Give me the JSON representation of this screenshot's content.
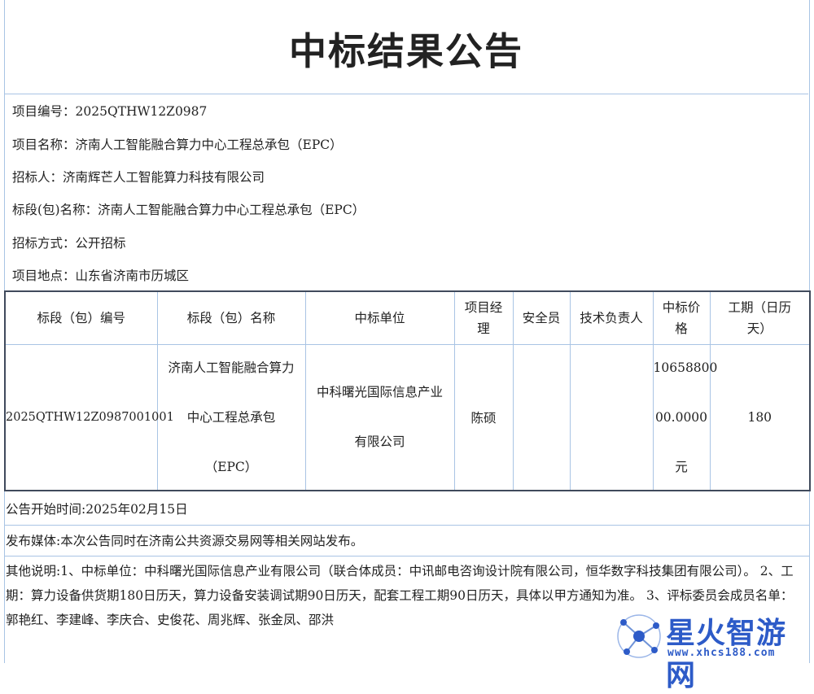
{
  "title": "中标结果公告",
  "info": {
    "project_no_label": "项目编号：",
    "project_no": "2025QTHW12Z0987",
    "project_name_label": "项目名称：",
    "project_name": "济南人工智能融合算力中心工程总承包（EPC）",
    "tenderer_label": "招标人：",
    "tenderer": "济南辉芒人工智能算力科技有限公司",
    "section_name_label": "标段(包)名称：",
    "section_name": "济南人工智能融合算力中心工程总承包（EPC）",
    "method_label": "招标方式：",
    "method": "公开招标",
    "location_label": "项目地点：",
    "location": "山东省济南市历城区"
  },
  "table": {
    "headers": {
      "section_no": "标段（包）编号",
      "section_name": "标段（包）名称",
      "winner": "中标单位",
      "pm_line1": "项目经",
      "pm_line2": "理",
      "safety": "安全员",
      "tech": "技术负责人",
      "price_line1": "中标价",
      "price_line2": "格",
      "period_line1": "工期（日历",
      "period_line2": "天）"
    },
    "row": {
      "section_no": "2025QTHW12Z0987001001",
      "section_name_line1": "济南人工智能融合算力",
      "section_name_line2": "中心工程总承包",
      "section_name_line3": "（EPC）",
      "winner_line1": "中科曙光国际信息产业",
      "winner_line2": "有限公司",
      "pm": "陈硕",
      "safety": "",
      "tech": "",
      "price_line1": "10658800",
      "price_line2": "00.0000",
      "price_line3": "元",
      "period": "180"
    }
  },
  "notice": {
    "start_time": "公告开始时间:2025年02月15日",
    "media": "发布媒体:本次公告同时在济南公共资源交易网等相关网站发布。",
    "other": "其他说明:1、中标单位：中科曙光国际信息产业有限公司（联合体成员：中讯邮电咨询设计院有限公司，恒华数字科技集团有限公司）。 2、工期：算力设备供货期180日历天，算力设备安装调试期90日历天，配套工程工期90日历天，具体以甲方通知为准。 3、评标委员会成员名单：郭艳红、李建峰、李庆合、史俊花、周兆辉、张金凤、邵洪"
  },
  "watermark": {
    "brand": "星火智游网",
    "url": "www.xhcs188.com",
    "brand_color": "#2d5bc8"
  }
}
